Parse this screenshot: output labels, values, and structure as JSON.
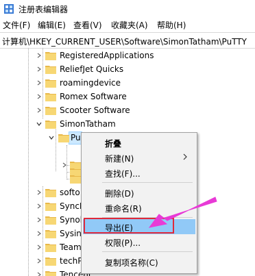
{
  "window": {
    "title": "注册表编辑器",
    "icon": "regedit-icon"
  },
  "menu": {
    "file": "文件(F)",
    "edit": "编辑(E)",
    "view": "查看(V)",
    "favorites": "收藏夹(A)",
    "help": "帮助(H)"
  },
  "address": {
    "path": "计算机\\HKEY_CURRENT_USER\\Software\\SimonTatham\\PuTTY"
  },
  "tree": {
    "nodes": [
      {
        "label": "RegisteredApplications",
        "expanded": false
      },
      {
        "label": "ReliefJet Quicks",
        "expanded": false
      },
      {
        "label": "roamingdevice",
        "expanded": false
      },
      {
        "label": "Romex Software",
        "expanded": false
      },
      {
        "label": "Scooter Software",
        "expanded": false
      },
      {
        "label": "SimonTatham",
        "expanded": true
      },
      {
        "label": "Pu",
        "expanded": true,
        "selected": true
      },
      {
        "label": "",
        "expanded": false
      },
      {
        "label": "",
        "expanded": false
      },
      {
        "label": "",
        "expanded": false
      },
      {
        "label": "softo",
        "expanded": false
      },
      {
        "label": "SyncE",
        "expanded": false
      },
      {
        "label": "Synol",
        "expanded": false
      },
      {
        "label": "Sysin",
        "expanded": false
      },
      {
        "label": "Team",
        "expanded": false
      },
      {
        "label": "techP",
        "expanded": false
      },
      {
        "label": "Tencent",
        "expanded": false
      }
    ]
  },
  "context_menu": {
    "items": [
      {
        "label": "折叠",
        "bold": true
      },
      {
        "label": "新建(N)",
        "submenu": true
      },
      {
        "label": "查找(F)..."
      },
      {
        "label": "删除(D)"
      },
      {
        "label": "重命名(R)"
      },
      {
        "label": "导出(E)",
        "highlighted": true
      },
      {
        "label": "权限(P)..."
      },
      {
        "label": "复制项名称(C)"
      }
    ]
  },
  "annotation": {
    "arrow_color": "#e83ad6",
    "box_color": "#e0293a"
  }
}
